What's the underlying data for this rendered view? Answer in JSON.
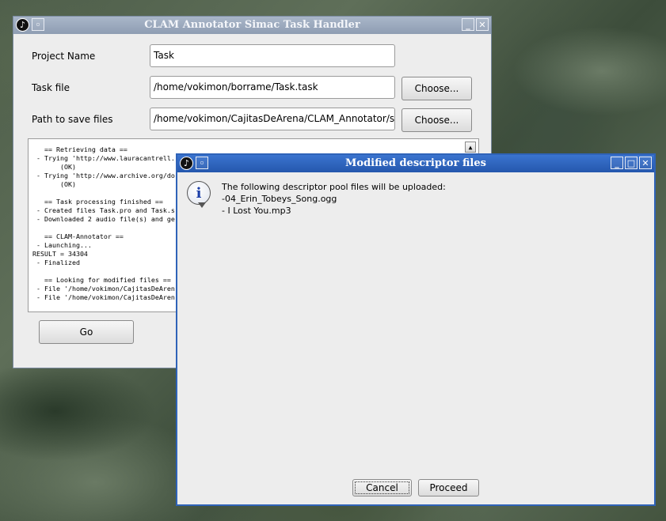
{
  "main_window": {
    "title": "CLAM Annotator Simac Task Handler",
    "project_name_label": "Project Name",
    "project_name_value": "Task",
    "task_file_label": "Task file",
    "task_file_value": "/home/vokimon/borrame/Task.task",
    "path_label": "Path to save files",
    "path_value": "/home/vokimon/CajitasDeArena/CLAM_Annotator/src",
    "choose_label": "Choose...",
    "go_label": "Go",
    "log_lines": [
      "   == Retrieving data ==",
      " - Trying 'http://www.lauracantrell.",
      "       (OK)",
      " - Trying 'http://www.archive.org/do",
      "       (OK)",
      "",
      "   == Task processing finished ==",
      " - Created files Task.pro and Task.s",
      " - Downloaded 2 audio file(s) and ge",
      "",
      "   == CLAM-Annotator ==",
      " - Launching...",
      "RESULT = 34304",
      " - Finalized",
      "",
      "   == Looking for modified files ==",
      " - File '/home/vokimon/CajitasDeAren",
      " - File '/home/vokimon/CajitasDeAren"
    ]
  },
  "dialog": {
    "title": "Modified descriptor files",
    "message": "The following descriptor pool files will be uploaded:",
    "files": [
      " -04_Erin_Tobeys_Song.ogg",
      " - I Lost You.mp3"
    ],
    "cancel_label": "Cancel",
    "proceed_label": "Proceed"
  },
  "icons": {
    "app": "app-icon",
    "window_menu": "window-menu-icon",
    "minimize": "minimize-icon",
    "maximize": "maximize-icon",
    "close": "close-icon",
    "info": "info-icon",
    "scroll_up": "scroll-up-arrow-icon"
  }
}
